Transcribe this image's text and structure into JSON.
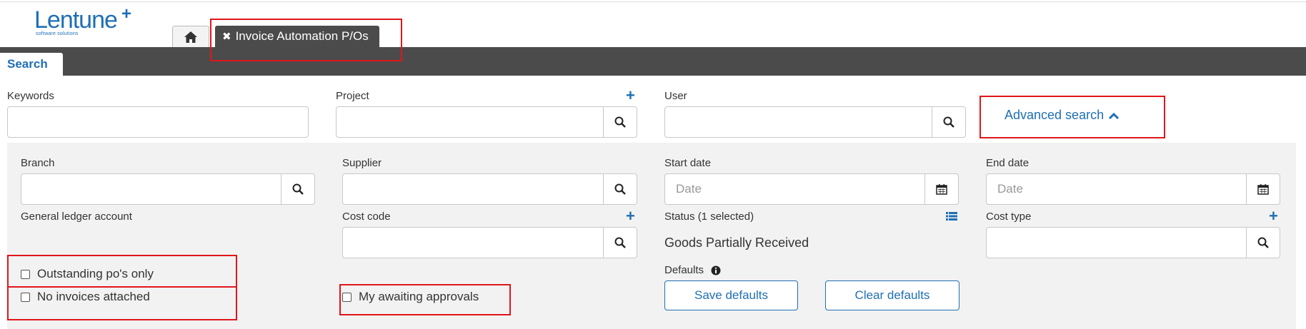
{
  "logo": {
    "name": "Lentune",
    "plus": "+",
    "tagline": "software solutions"
  },
  "tabs": {
    "active_label": "Invoice Automation P/Os",
    "close_glyph": "✖"
  },
  "search_tab": {
    "label": "Search"
  },
  "filters": {
    "keywords": {
      "label": "Keywords",
      "value": ""
    },
    "project": {
      "label": "Project",
      "value": ""
    },
    "user": {
      "label": "User",
      "value": ""
    },
    "advanced_search": {
      "label": "Advanced search"
    }
  },
  "advanced": {
    "branch": {
      "label": "Branch",
      "value": ""
    },
    "supplier": {
      "label": "Supplier",
      "value": ""
    },
    "start_date": {
      "label": "Start date",
      "placeholder": "Date"
    },
    "end_date": {
      "label": "End date",
      "placeholder": "Date"
    },
    "gl_account": {
      "label": "General ledger account"
    },
    "cost_code": {
      "label": "Cost code",
      "value": ""
    },
    "status": {
      "label": "Status (1 selected)",
      "value": "Goods Partially Received"
    },
    "cost_type": {
      "label": "Cost type",
      "value": ""
    },
    "checkboxes": {
      "outstanding": {
        "label": "Outstanding po's only",
        "checked": false
      },
      "no_invoices": {
        "label": "No invoices attached",
        "checked": false
      },
      "awaiting": {
        "label": "My awaiting approvals",
        "checked": false
      }
    },
    "defaults": {
      "label": "Defaults",
      "save_label": "Save defaults",
      "clear_label": "Clear defaults"
    }
  },
  "colors": {
    "accent": "#1f6fb5",
    "dark_bar": "#4b4b4b",
    "panel": "#f2f2f2",
    "highlight": "#e0161b"
  },
  "icons": [
    "home-icon",
    "close-icon",
    "search-icon",
    "plus-icon",
    "chevron-up-icon",
    "calendar-icon",
    "list-icon",
    "info-icon"
  ]
}
